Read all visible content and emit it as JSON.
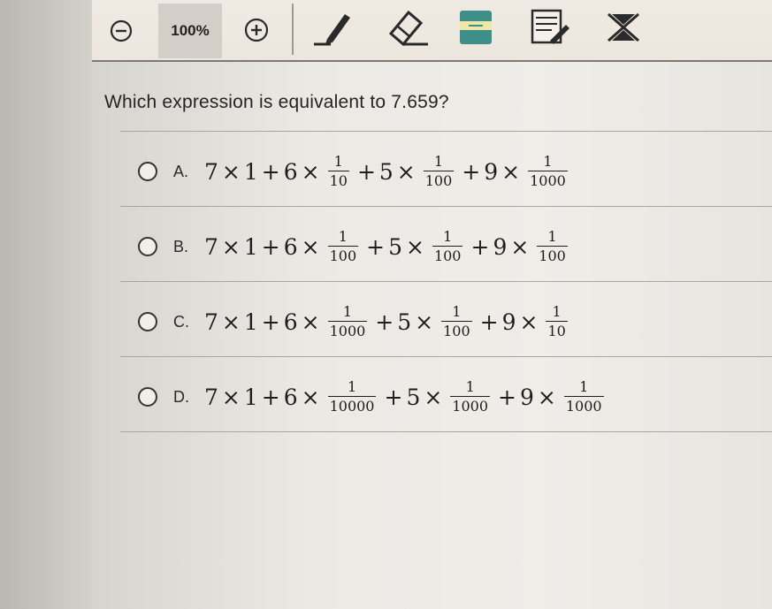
{
  "toolbar": {
    "zoom_level": "100%",
    "tools": [
      {
        "name": "zoom-out",
        "icon": "minus-circle-icon"
      },
      {
        "name": "zoom-in",
        "icon": "plus-circle-icon"
      },
      {
        "name": "pencil",
        "icon": "pencil-icon"
      },
      {
        "name": "eraser",
        "icon": "eraser-icon"
      },
      {
        "name": "highlighter",
        "icon": "highlighter-icon"
      },
      {
        "name": "notepad",
        "icon": "notepad-icon"
      },
      {
        "name": "answer-eliminator",
        "icon": "cross-out-icon"
      }
    ]
  },
  "question": {
    "text": "Which expression is equivalent to 7.659?"
  },
  "choices": [
    {
      "letter": "A.",
      "terms": {
        "a": "7",
        "times1": "×",
        "b": "1",
        "plus1": "+",
        "c": "6",
        "times2": "×",
        "f1_num": "1",
        "f1_den": "10",
        "plus2": "+",
        "d": "5",
        "times3": "×",
        "f2_num": "1",
        "f2_den": "100",
        "plus3": "+",
        "e": "9",
        "times4": "×",
        "f3_num": "1",
        "f3_den": "1000"
      }
    },
    {
      "letter": "B.",
      "terms": {
        "a": "7",
        "times1": "×",
        "b": "1",
        "plus1": "+",
        "c": "6",
        "times2": "×",
        "f1_num": "1",
        "f1_den": "100",
        "plus2": "+",
        "d": "5",
        "times3": "×",
        "f2_num": "1",
        "f2_den": "100",
        "plus3": "+",
        "e": "9",
        "times4": "×",
        "f3_num": "1",
        "f3_den": "100"
      }
    },
    {
      "letter": "C.",
      "terms": {
        "a": "7",
        "times1": "×",
        "b": "1",
        "plus1": "+",
        "c": "6",
        "times2": "×",
        "f1_num": "1",
        "f1_den": "1000",
        "plus2": "+",
        "d": "5",
        "times3": "×",
        "f2_num": "1",
        "f2_den": "100",
        "plus3": "+",
        "e": "9",
        "times4": "×",
        "f3_num": "1",
        "f3_den": "10"
      }
    },
    {
      "letter": "D.",
      "terms": {
        "a": "7",
        "times1": "×",
        "b": "1",
        "plus1": "+",
        "c": "6",
        "times2": "×",
        "f1_num": "1",
        "f1_den": "10000",
        "plus2": "+",
        "d": "5",
        "times3": "×",
        "f2_num": "1",
        "f2_den": "1000",
        "plus3": "+",
        "e": "9",
        "times4": "×",
        "f3_num": "1",
        "f3_den": "1000"
      }
    }
  ],
  "colors": {
    "toolbar_bg": "#ece6de",
    "zoom_box_bg": "#d3cec7",
    "text": "#242424",
    "divider": "#a9a6a0",
    "highlighter_teal": "#3d8f88",
    "highlighter_fill": "#efe7a8"
  }
}
